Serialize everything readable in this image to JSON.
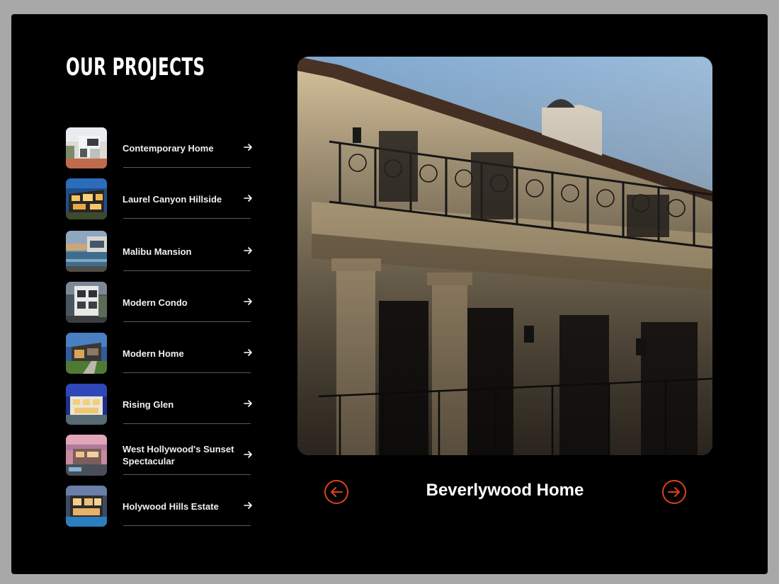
{
  "page": {
    "title": "OUR PROJECTS"
  },
  "projects": [
    {
      "label": "Contemporary Home",
      "thumb": "contemporary-home-thumb"
    },
    {
      "label": "Laurel Canyon Hillside",
      "thumb": "laurel-canyon-thumb"
    },
    {
      "label": "Malibu Mansion",
      "thumb": "malibu-mansion-thumb"
    },
    {
      "label": "Modern Condo",
      "thumb": "modern-condo-thumb"
    },
    {
      "label": "Modern Home",
      "thumb": "modern-home-thumb"
    },
    {
      "label": "Rising Glen",
      "thumb": "rising-glen-thumb"
    },
    {
      "label": "West Hollywood's Sunset Spectacular",
      "thumb": "west-hollywood-thumb"
    },
    {
      "label": "Holywood Hills Estate",
      "thumb": "holywood-hills-thumb"
    }
  ],
  "featured": {
    "caption": "Beverlywood Home",
    "image": "beverlywood-home-photo"
  },
  "controls": {
    "prev_icon": "arrow-left-circle-icon",
    "next_icon": "arrow-right-circle-icon",
    "item_arrow_icon": "arrow-right-icon"
  },
  "colors": {
    "background": "#000000",
    "frame": "#a9a8a9",
    "accent": "#e0411a",
    "text": "#ffffff",
    "divider": "#5a5a5a"
  }
}
